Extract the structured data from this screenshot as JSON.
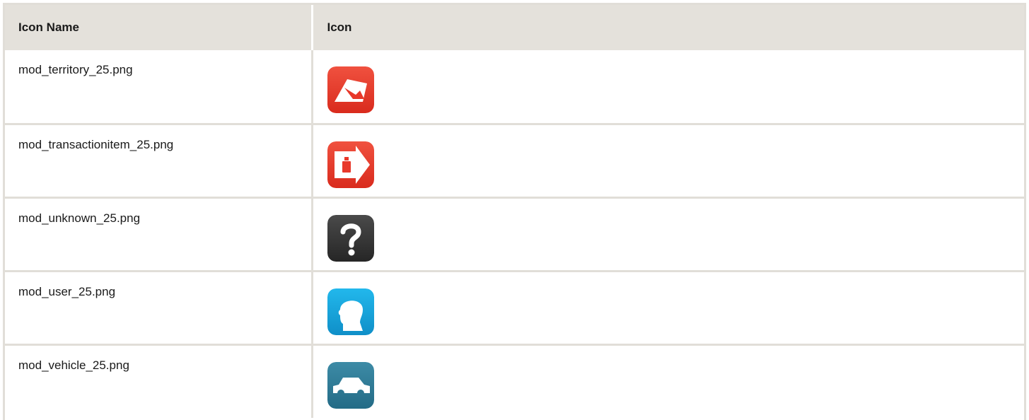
{
  "table": {
    "headers": [
      "Icon Name",
      "Icon"
    ],
    "rows": [
      {
        "name": "mod_territory_25.png",
        "icon": "territory-icon",
        "color": "#e8382a"
      },
      {
        "name": "mod_transactionitem_25.png",
        "icon": "transaction-item-icon",
        "color": "#e8382a"
      },
      {
        "name": "mod_unknown_25.png",
        "icon": "unknown-icon",
        "color": "#3a3a3a"
      },
      {
        "name": "mod_user_25.png",
        "icon": "user-icon",
        "color": "#1aa6dc"
      },
      {
        "name": "mod_vehicle_25.png",
        "icon": "vehicle-icon",
        "color": "#2f7c97"
      }
    ]
  },
  "colors": {
    "header_bg": "#e4e1db",
    "border": "#e1ded8"
  }
}
